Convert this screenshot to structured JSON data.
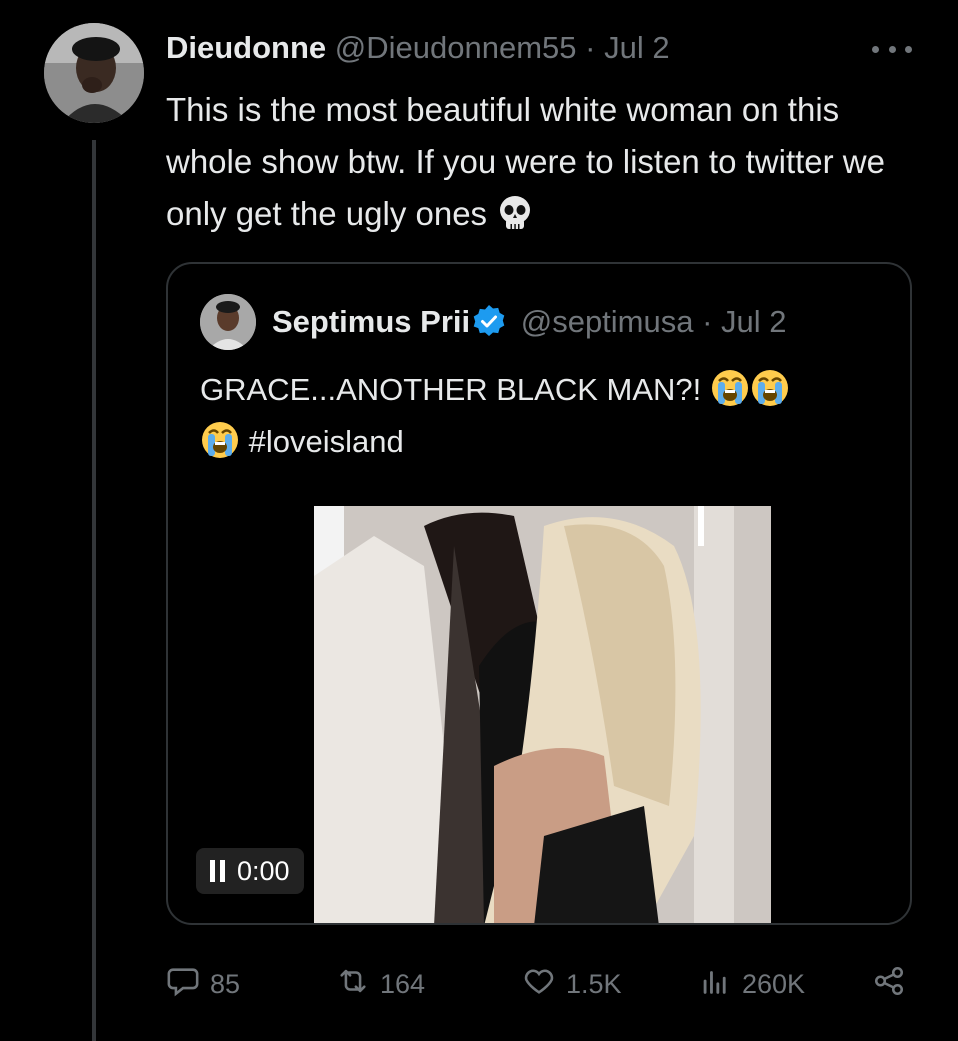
{
  "tweet": {
    "author_name": "Dieudonne",
    "author_handle": "@Dieudonnem55",
    "date": "· Jul 2",
    "text": "This is the most beautiful white woman on this whole show btw. If you were to listen to twitter we only get the ugly ones",
    "emoji_icon": "skull-emoji"
  },
  "quoted": {
    "author_name": "Septimus Prii",
    "author_handle": "@septimusa",
    "date": "· Jul 2",
    "text_main": "GRACE...ANOTHER BLACK MAN?!",
    "hashtag": "#loveisland",
    "emoji_icon": "loudly-crying-face-emoji",
    "video_time": "0:00"
  },
  "actions": {
    "replies": "85",
    "reposts": "164",
    "likes": "1.5K",
    "views": "260K"
  },
  "colors": {
    "background": "#000000",
    "text": "#e7e9ea",
    "muted": "#71767b",
    "border": "#2f3336",
    "verified": "#1d9bf0"
  }
}
